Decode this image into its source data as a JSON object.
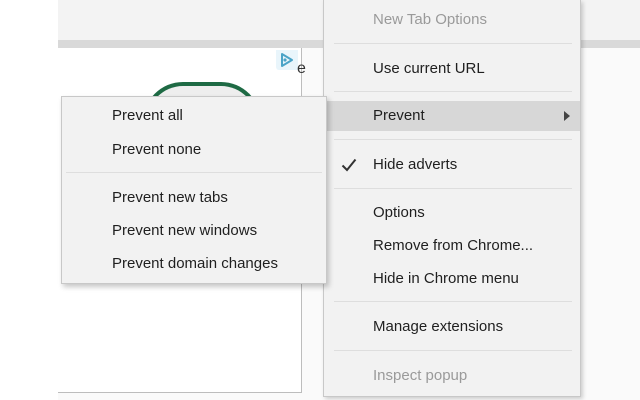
{
  "context_menu": {
    "items": [
      {
        "label": "New Tab Options",
        "state": "disabled"
      },
      {
        "label": "Use current URL",
        "state": "enabled"
      },
      {
        "label": "Prevent",
        "state": "highlighted",
        "has_submenu": true,
        "arrow_icon": "chevron-right-icon"
      },
      {
        "label": "Hide adverts",
        "state": "enabled",
        "checked": true,
        "check_icon": "checkmark-icon"
      },
      {
        "label": "Options",
        "state": "enabled"
      },
      {
        "label": "Remove from Chrome...",
        "state": "enabled"
      },
      {
        "label": "Hide in Chrome menu",
        "state": "enabled"
      },
      {
        "label": "Manage extensions",
        "state": "enabled"
      },
      {
        "label": "Inspect popup",
        "state": "disabled"
      }
    ]
  },
  "submenu": {
    "parent": "Prevent",
    "items": [
      {
        "label": "Prevent all"
      },
      {
        "label": "Prevent none"
      },
      {
        "label": "Prevent new tabs"
      },
      {
        "label": "Prevent new windows"
      },
      {
        "label": "Prevent domain changes"
      }
    ]
  },
  "page": {
    "ad_badge_icon": "adchoices-icon",
    "ad_partial_text": "e"
  },
  "colors": {
    "menu_background": "#f2f2f2",
    "highlight": "#d7d7d7",
    "disabled_text": "#9a9a9a",
    "text": "#1f1f1f",
    "ad_logo_ring": "#1e6a44",
    "ad_badge": "#49a3c7"
  }
}
